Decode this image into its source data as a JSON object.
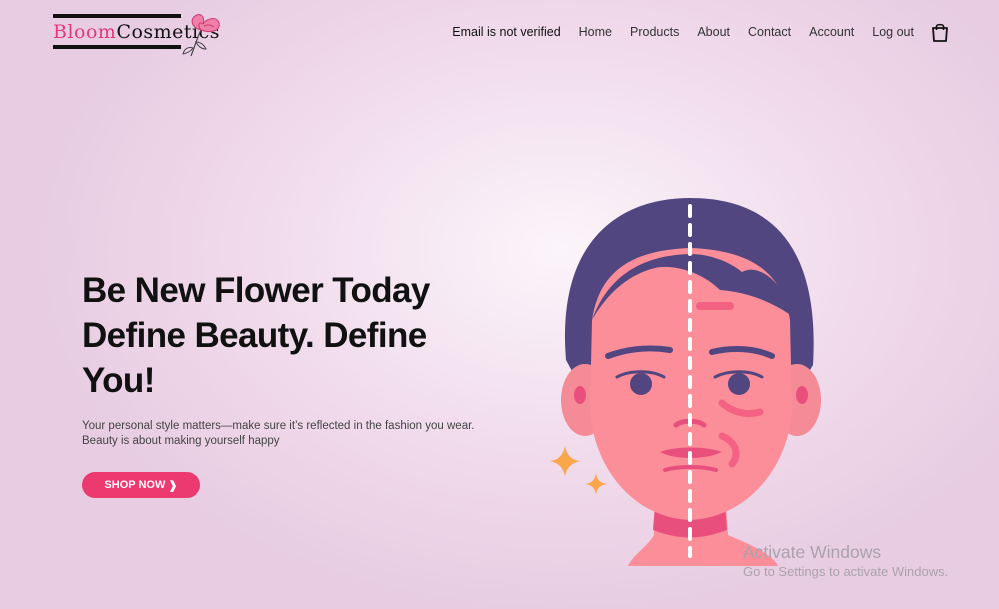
{
  "brand": {
    "logo_word1": "Bloom",
    "logo_word2": "Cosmetics",
    "accent_color": "#e4387b"
  },
  "nav": {
    "status": "Email is not verified",
    "links": [
      "Home",
      "Products",
      "About",
      "Contact",
      "Account",
      "Log out"
    ],
    "cart_icon": "shopping-bag-icon"
  },
  "hero": {
    "title_lines": [
      "Be New Flower Today",
      "Define Beauty. Define",
      "You!"
    ],
    "description_lines": [
      "Your personal style matters—make sure it’s reflected in the fashion you wear.",
      "Beauty is about making yourself happy"
    ],
    "cta_label": "SHOP NOW",
    "cta_color": "#ec3a71"
  },
  "illustration": {
    "icon": "face-illustration",
    "colors": {
      "hair": "#524680",
      "skin": "#fb8e98",
      "accent": "#f9a64d"
    }
  },
  "os_watermark": {
    "title": "Activate Windows",
    "subtitle": "Go to Settings to activate Windows."
  }
}
